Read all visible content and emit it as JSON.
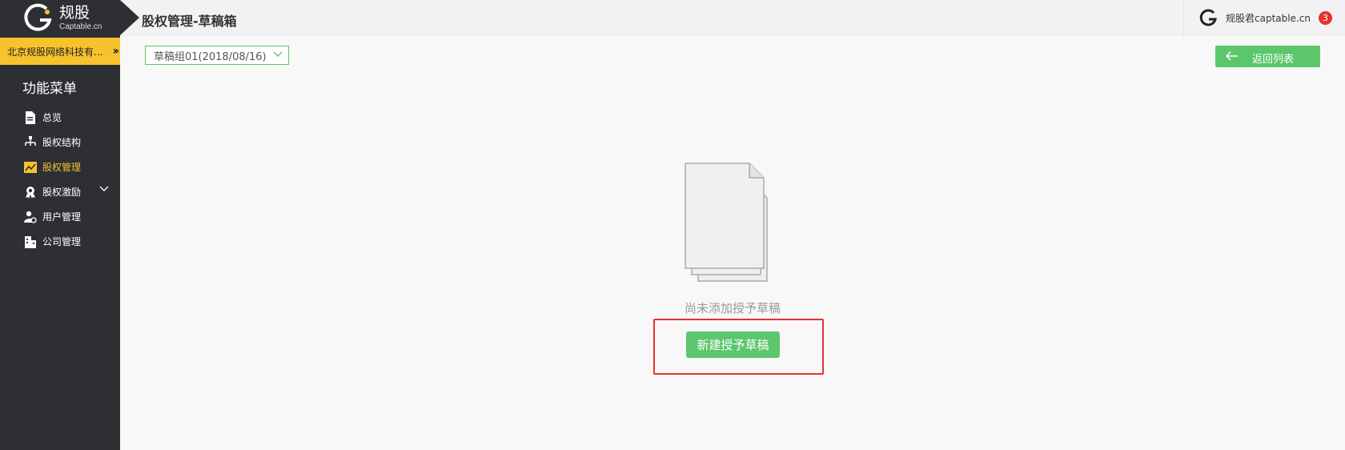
{
  "brand": {
    "title": "规股",
    "subtitle": "Captable.cn"
  },
  "company": {
    "name": "北京规股网络科技有...",
    "expand_icon": "double-chevron-right-icon"
  },
  "menu": {
    "title": "功能菜单",
    "items": [
      {
        "label": "总览",
        "icon": "document-icon",
        "active": false
      },
      {
        "label": "股权结构",
        "icon": "org-chart-icon",
        "active": false
      },
      {
        "label": "股权管理",
        "icon": "trend-chart-icon",
        "active": true
      },
      {
        "label": "股权激励",
        "icon": "award-icon",
        "active": false,
        "expandable": true
      },
      {
        "label": "用户管理",
        "icon": "user-settings-icon",
        "active": false
      },
      {
        "label": "公司管理",
        "icon": "building-icon",
        "active": false
      }
    ]
  },
  "header": {
    "page_title": "股权管理-草稿箱",
    "user_name": "规股君captable.cn",
    "notification_count": "3"
  },
  "main": {
    "draft_group_selected": "草稿组01(2018/08/16)",
    "back_button_label": "返回列表",
    "empty_message": "尚未添加授予草稿",
    "new_button_label": "新建授予草稿"
  },
  "colors": {
    "sidebar_bg": "#2d2f33",
    "accent_yellow": "#f7c32d",
    "primary_green": "#5cc66d",
    "highlight_red": "#e5322d"
  }
}
